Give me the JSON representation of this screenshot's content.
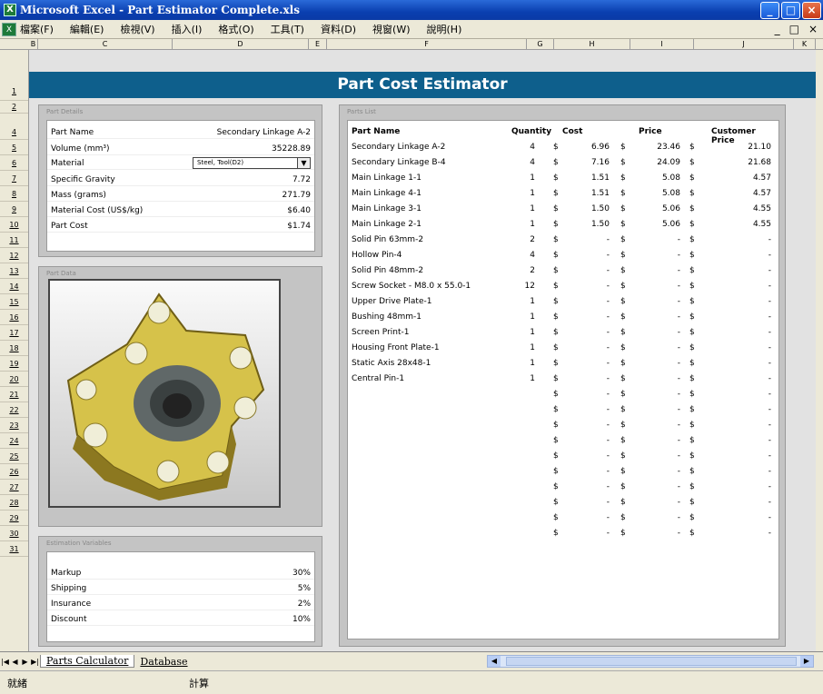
{
  "window": {
    "title": "Microsoft Excel - Part Estimator Complete.xls",
    "icon": "excel-icon"
  },
  "menu": {
    "items": [
      "檔案(F)",
      "編輯(E)",
      "檢視(V)",
      "插入(I)",
      "格式(O)",
      "工具(T)",
      "資料(D)",
      "視窗(W)",
      "說明(H)"
    ],
    "right": [
      "_",
      "□",
      "×"
    ]
  },
  "columns": [
    "B",
    "C",
    "D",
    "E",
    "F",
    "G",
    "H",
    "I",
    "J",
    "K"
  ],
  "rows": [
    "1",
    "2",
    "4",
    "5",
    "6",
    "7",
    "8",
    "9",
    "10",
    "11",
    "12",
    "13",
    "14",
    "15",
    "16",
    "17",
    "18",
    "19",
    "20",
    "21",
    "22",
    "23",
    "24",
    "25",
    "26",
    "27",
    "28",
    "29",
    "30",
    "31"
  ],
  "sheet": {
    "title": "Part Cost Estimator",
    "part_details": {
      "label": "Part Details",
      "part_name_label": "Part Name",
      "part_name": "Secondary Linkage A-2",
      "volume_label": "Volume (mm³)",
      "volume": "35228.89",
      "material_label": "Material",
      "material": "Steel, Tool(D2)",
      "gravity_label": "Specific Gravity",
      "gravity": "7.72",
      "mass_label": "Mass (grams)",
      "mass": "271.79",
      "matcost_label": "Material Cost (US$/kg)",
      "matcost": "$6.40",
      "partcost_label": "Part Cost",
      "partcost": "$1.74"
    },
    "part_data": {
      "label": "Part Data"
    },
    "estimation": {
      "label": "Estimation Variables",
      "items": [
        {
          "k": "Markup",
          "v": "30%"
        },
        {
          "k": "Shipping",
          "v": "5%"
        },
        {
          "k": "Insurance",
          "v": "2%"
        },
        {
          "k": "Discount",
          "v": "10%"
        }
      ]
    },
    "parts_list": {
      "label": "Parts List",
      "headers": [
        "Part Name",
        "Quantity",
        "Cost",
        "Price",
        "Customer Price"
      ],
      "rows": [
        [
          "Secondary Linkage A-2",
          "4",
          "$",
          "6.96",
          "$",
          "23.46",
          "$",
          "21.10"
        ],
        [
          "Secondary Linkage B-4",
          "4",
          "$",
          "7.16",
          "$",
          "24.09",
          "$",
          "21.68"
        ],
        [
          "Main Linkage 1-1",
          "1",
          "$",
          "1.51",
          "$",
          "5.08",
          "$",
          "4.57"
        ],
        [
          "Main Linkage 4-1",
          "1",
          "$",
          "1.51",
          "$",
          "5.08",
          "$",
          "4.57"
        ],
        [
          "Main Linkage 3-1",
          "1",
          "$",
          "1.50",
          "$",
          "5.06",
          "$",
          "4.55"
        ],
        [
          "Main Linkage 2-1",
          "1",
          "$",
          "1.50",
          "$",
          "5.06",
          "$",
          "4.55"
        ],
        [
          "Solid Pin 63mm-2",
          "2",
          "$",
          "-",
          "$",
          "-",
          "$",
          "-"
        ],
        [
          "Hollow Pin-4",
          "4",
          "$",
          "-",
          "$",
          "-",
          "$",
          "-"
        ],
        [
          "Solid Pin 48mm-2",
          "2",
          "$",
          "-",
          "$",
          "-",
          "$",
          "-"
        ],
        [
          "Screw Socket - M8.0 x 55.0-1",
          "12",
          "$",
          "-",
          "$",
          "-",
          "$",
          "-"
        ],
        [
          "Upper Drive Plate-1",
          "1",
          "$",
          "-",
          "$",
          "-",
          "$",
          "-"
        ],
        [
          "Bushing 48mm-1",
          "1",
          "$",
          "-",
          "$",
          "-",
          "$",
          "-"
        ],
        [
          "Screen Print-1",
          "1",
          "$",
          "-",
          "$",
          "-",
          "$",
          "-"
        ],
        [
          "Housing Front Plate-1",
          "1",
          "$",
          "-",
          "$",
          "-",
          "$",
          "-"
        ],
        [
          "Static Axis 28x48-1",
          "1",
          "$",
          "-",
          "$",
          "-",
          "$",
          "-"
        ],
        [
          "Central Pin-1",
          "1",
          "$",
          "-",
          "$",
          "-",
          "$",
          "-"
        ],
        [
          "",
          "",
          "$",
          "-",
          "$",
          "-",
          "$",
          "-"
        ],
        [
          "",
          "",
          "$",
          "-",
          "$",
          "-",
          "$",
          "-"
        ],
        [
          "",
          "",
          "$",
          "-",
          "$",
          "-",
          "$",
          "-"
        ],
        [
          "",
          "",
          "$",
          "-",
          "$",
          "-",
          "$",
          "-"
        ],
        [
          "",
          "",
          "$",
          "-",
          "$",
          "-",
          "$",
          "-"
        ],
        [
          "",
          "",
          "$",
          "-",
          "$",
          "-",
          "$",
          "-"
        ],
        [
          "",
          "",
          "$",
          "-",
          "$",
          "-",
          "$",
          "-"
        ],
        [
          "",
          "",
          "$",
          "-",
          "$",
          "-",
          "$",
          "-"
        ],
        [
          "",
          "",
          "$",
          "-",
          "$",
          "-",
          "$",
          "-"
        ],
        [
          "",
          "",
          "$",
          "-",
          "$",
          "-",
          "$",
          "-"
        ]
      ]
    }
  },
  "tabs": {
    "first": "|◀",
    "prev": "◀",
    "next": "▶",
    "last": "▶|",
    "active": "Parts Calculator",
    "other": "Database"
  },
  "status": {
    "ready": "就緒",
    "calc": "計算"
  }
}
